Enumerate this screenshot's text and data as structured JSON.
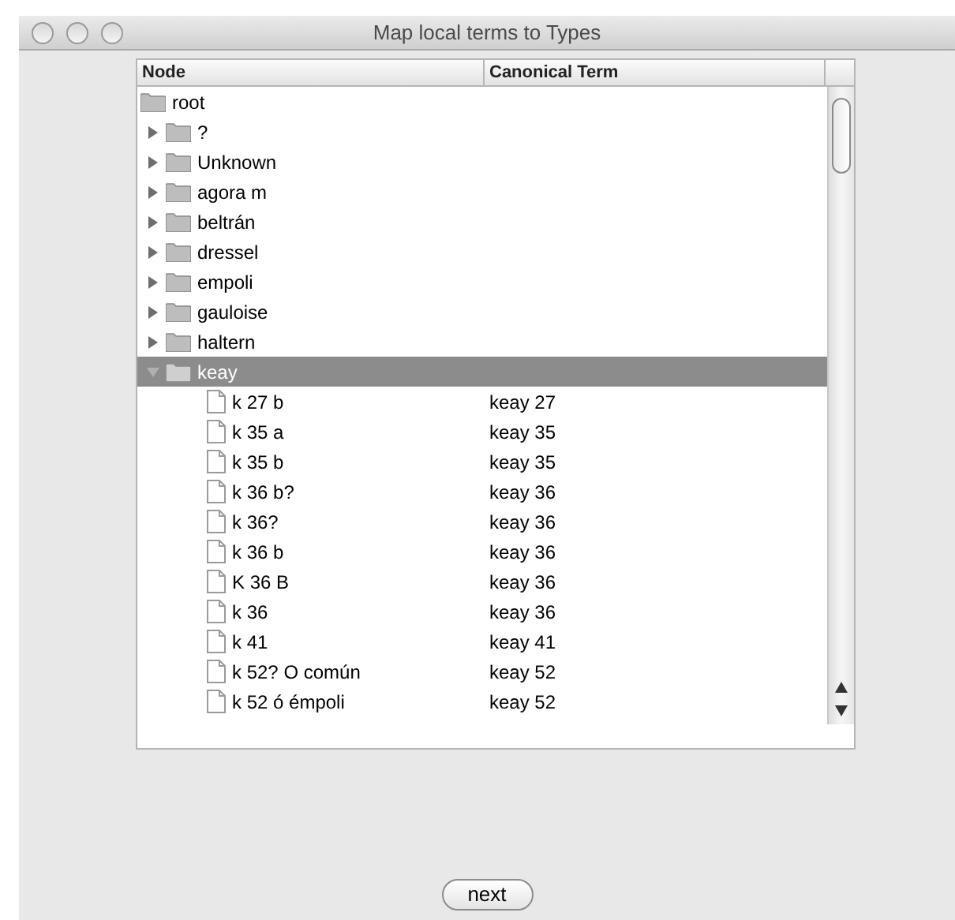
{
  "window": {
    "title": "Map local terms to Types"
  },
  "table": {
    "columns": [
      "Node",
      "Canonical Term"
    ],
    "root": {
      "label": "root",
      "selected": false,
      "children": [
        {
          "label": "?",
          "expanded": false,
          "selected": false
        },
        {
          "label": "Unknown",
          "expanded": false,
          "selected": false
        },
        {
          "label": "agora m",
          "expanded": false,
          "selected": false
        },
        {
          "label": "beltrán",
          "expanded": false,
          "selected": false
        },
        {
          "label": "dressel",
          "expanded": false,
          "selected": false
        },
        {
          "label": "empoli",
          "expanded": false,
          "selected": false
        },
        {
          "label": "gauloise",
          "expanded": false,
          "selected": false
        },
        {
          "label": "haltern",
          "expanded": false,
          "selected": false
        },
        {
          "label": "keay",
          "expanded": true,
          "selected": true,
          "children": [
            {
              "label": "k 27 b",
              "term": "keay 27",
              "selected": false
            },
            {
              "label": "k 35 a",
              "term": "keay 35",
              "selected": false
            },
            {
              "label": "k 35 b",
              "term": "keay 35",
              "selected": false
            },
            {
              "label": "k 36 b?",
              "term": "keay 36",
              "selected": false
            },
            {
              "label": "k 36?",
              "term": "keay 36",
              "selected": false
            },
            {
              "label": "k 36 b",
              "term": "keay 36",
              "selected": false
            },
            {
              "label": "K 36 B",
              "term": "keay 36",
              "selected": false
            },
            {
              "label": "k 36",
              "term": "keay 36",
              "selected": false
            },
            {
              "label": "k 41",
              "term": "keay 41",
              "selected": false
            },
            {
              "label": "k 52? O común",
              "term": "keay 52",
              "selected": false
            },
            {
              "label": "k 52 ó émpoli",
              "term": "keay 52",
              "selected": false
            }
          ]
        }
      ]
    }
  },
  "buttons": [
    {
      "label": "next"
    }
  ]
}
